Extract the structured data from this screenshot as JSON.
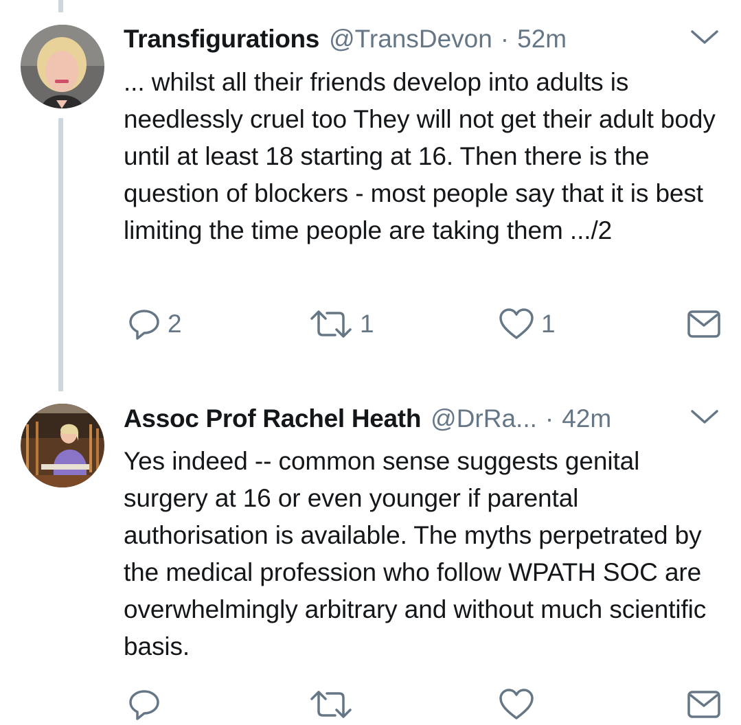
{
  "tweets": [
    {
      "name": "Transfigurations",
      "handle": "@TransDevon",
      "separator": "·",
      "time": "52m",
      "text": "... whilst all their friends develop into adults is needlessly cruel too  They will not get their adult body until at least 18 starting at 16. Then there is the question of blockers - most people say that it is best limiting the time people are taking them .../2",
      "replies": "2",
      "retweets": "1",
      "likes": "1"
    },
    {
      "name": "Assoc Prof Rachel Heath",
      "handle": "@DrRa...",
      "separator": "·",
      "time": "42m",
      "text": "Yes indeed -- common sense suggests genital surgery at 16 or even younger if parental authorisation is available. The myths perpetrated by the medical profession who follow WPATH SOC are overwhelmingly arbitrary and without much scientific basis.",
      "replies": "",
      "retweets": "",
      "likes": ""
    }
  ],
  "icons": {
    "reply": "reply-icon",
    "retweet": "retweet-icon",
    "like": "heart-icon",
    "dm": "envelope-icon",
    "caret": "chevron-down-icon"
  },
  "colors": {
    "text": "#14171a",
    "secondary": "#657786",
    "thread_line": "#ccd6dd"
  }
}
